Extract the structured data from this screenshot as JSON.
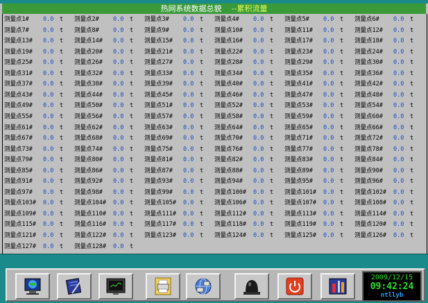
{
  "header": {
    "title": "热网系统数据总貌",
    "subtitle": "--累积流量"
  },
  "measurement": {
    "prefix": "测量点",
    "unit": "t",
    "columns": 6,
    "points": [
      {
        "label": "测量点1#",
        "value": "0.0"
      },
      {
        "label": "测量点2#",
        "value": "0.0"
      },
      {
        "label": "测量点3#",
        "value": "0.0"
      },
      {
        "label": "测量点4#",
        "value": "0.0"
      },
      {
        "label": "测量点5#",
        "value": "0.0"
      },
      {
        "label": "测量点6#",
        "value": "0.0"
      },
      {
        "label": "测量点7#",
        "value": "0.0"
      },
      {
        "label": "测量点8#",
        "value": "0.0"
      },
      {
        "label": "测量点9#",
        "value": "0.0"
      },
      {
        "label": "测量点10#",
        "value": "0.0"
      },
      {
        "label": "测量点11#",
        "value": "0.0"
      },
      {
        "label": "测量点12#",
        "value": "0.0"
      },
      {
        "label": "测量点13#",
        "value": "0.0"
      },
      {
        "label": "测量点14#",
        "value": "0.0"
      },
      {
        "label": "测量点15#",
        "value": "0.0"
      },
      {
        "label": "测量点16#",
        "value": "0.0"
      },
      {
        "label": "测量点17#",
        "value": "0.0"
      },
      {
        "label": "测量点18#",
        "value": "0.0"
      },
      {
        "label": "测量点19#",
        "value": "0.0"
      },
      {
        "label": "测量点20#",
        "value": "0.0"
      },
      {
        "label": "测量点21#",
        "value": "0.0"
      },
      {
        "label": "测量点22#",
        "value": "0.0"
      },
      {
        "label": "测量点23#",
        "value": "0.0"
      },
      {
        "label": "测量点24#",
        "value": "0.0"
      },
      {
        "label": "测量点25#",
        "value": "0.0"
      },
      {
        "label": "测量点26#",
        "value": "0.0"
      },
      {
        "label": "测量点27#",
        "value": "0.0"
      },
      {
        "label": "测量点28#",
        "value": "0.0"
      },
      {
        "label": "测量点29#",
        "value": "0.0"
      },
      {
        "label": "测量点30#",
        "value": "0.0"
      },
      {
        "label": "测量点31#",
        "value": "0.0"
      },
      {
        "label": "测量点32#",
        "value": "0.0"
      },
      {
        "label": "测量点33#",
        "value": "0.0"
      },
      {
        "label": "测量点34#",
        "value": "0.0"
      },
      {
        "label": "测量点35#",
        "value": "0.0"
      },
      {
        "label": "测量点36#",
        "value": "0.0"
      },
      {
        "label": "测量点37#",
        "value": "0.0"
      },
      {
        "label": "测量点38#",
        "value": "0.0"
      },
      {
        "label": "测量点39#",
        "value": "0.0"
      },
      {
        "label": "测量点40#",
        "value": "0.0"
      },
      {
        "label": "测量点41#",
        "value": "0.0"
      },
      {
        "label": "测量点42#",
        "value": "0.0"
      },
      {
        "label": "测量点43#",
        "value": "0.0"
      },
      {
        "label": "测量点44#",
        "value": "0.0"
      },
      {
        "label": "测量点45#",
        "value": "0.0"
      },
      {
        "label": "测量点46#",
        "value": "0.0"
      },
      {
        "label": "测量点47#",
        "value": "0.0"
      },
      {
        "label": "测量点48#",
        "value": "0.0"
      },
      {
        "label": "测量点49#",
        "value": "0.0"
      },
      {
        "label": "测量点50#",
        "value": "0.0"
      },
      {
        "label": "测量点51#",
        "value": "0.0"
      },
      {
        "label": "测量点52#",
        "value": "0.0"
      },
      {
        "label": "测量点53#",
        "value": "0.0"
      },
      {
        "label": "测量点54#",
        "value": "0.0"
      },
      {
        "label": "测量点55#",
        "value": "0.0"
      },
      {
        "label": "测量点56#",
        "value": "0.0"
      },
      {
        "label": "测量点57#",
        "value": "0.0"
      },
      {
        "label": "测量点58#",
        "value": "0.0"
      },
      {
        "label": "测量点59#",
        "value": "0.0"
      },
      {
        "label": "测量点60#",
        "value": "0.0"
      },
      {
        "label": "测量点61#",
        "value": "0.0"
      },
      {
        "label": "测量点62#",
        "value": "0.0"
      },
      {
        "label": "测量点63#",
        "value": "0.0"
      },
      {
        "label": "测量点64#",
        "value": "0.0"
      },
      {
        "label": "测量点65#",
        "value": "0.0"
      },
      {
        "label": "测量点66#",
        "value": "0.0"
      },
      {
        "label": "测量点67#",
        "value": "0.0"
      },
      {
        "label": "测量点68#",
        "value": "0.0"
      },
      {
        "label": "测量点69#",
        "value": "0.0"
      },
      {
        "label": "测量点70#",
        "value": "0.0"
      },
      {
        "label": "测量点71#",
        "value": "0.0"
      },
      {
        "label": "测量点72#",
        "value": "0.0"
      },
      {
        "label": "测量点73#",
        "value": "0.0"
      },
      {
        "label": "测量点74#",
        "value": "0.0"
      },
      {
        "label": "测量点75#",
        "value": "0.0"
      },
      {
        "label": "测量点76#",
        "value": "0.0"
      },
      {
        "label": "测量点77#",
        "value": "0.0"
      },
      {
        "label": "测量点78#",
        "value": "0.0"
      },
      {
        "label": "测量点79#",
        "value": "0.0"
      },
      {
        "label": "测量点80#",
        "value": "0.0"
      },
      {
        "label": "测量点81#",
        "value": "0.0"
      },
      {
        "label": "测量点82#",
        "value": "0.0"
      },
      {
        "label": "测量点83#",
        "value": "0.0"
      },
      {
        "label": "测量点84#",
        "value": "0.0"
      },
      {
        "label": "测量点85#",
        "value": "0.0"
      },
      {
        "label": "测量点86#",
        "value": "0.0"
      },
      {
        "label": "测量点87#",
        "value": "0.0"
      },
      {
        "label": "测量点88#",
        "value": "0.0"
      },
      {
        "label": "测量点89#",
        "value": "0.0"
      },
      {
        "label": "测量点90#",
        "value": "0.0"
      },
      {
        "label": "测量点91#",
        "value": "0.0"
      },
      {
        "label": "测量点92#",
        "value": "0.0"
      },
      {
        "label": "测量点93#",
        "value": "0.0"
      },
      {
        "label": "测量点94#",
        "value": "0.0"
      },
      {
        "label": "测量点95#",
        "value": "0.0"
      },
      {
        "label": "测量点96#",
        "value": "0.0"
      },
      {
        "label": "测量点97#",
        "value": "0.0"
      },
      {
        "label": "测量点98#",
        "value": "0.0"
      },
      {
        "label": "测量点99#",
        "value": "0.0"
      },
      {
        "label": "测量点100#",
        "value": "0.0"
      },
      {
        "label": "测量点101#",
        "value": "0.0"
      },
      {
        "label": "测量点102#",
        "value": "0.0"
      },
      {
        "label": "测量点103#",
        "value": "0.0"
      },
      {
        "label": "测量点104#",
        "value": "0.0"
      },
      {
        "label": "测量点105#",
        "value": "0.0"
      },
      {
        "label": "测量点106#",
        "value": "0.0"
      },
      {
        "label": "测量点107#",
        "value": "0.0"
      },
      {
        "label": "测量点108#",
        "value": "0.0"
      },
      {
        "label": "测量点109#",
        "value": "0.0"
      },
      {
        "label": "测量点110#",
        "value": "0.0"
      },
      {
        "label": "测量点111#",
        "value": "0.0"
      },
      {
        "label": "测量点112#",
        "value": "0.0"
      },
      {
        "label": "测量点113#",
        "value": "0.0"
      },
      {
        "label": "测量点114#",
        "value": "0.0"
      },
      {
        "label": "测量点115#",
        "value": "0.0"
      },
      {
        "label": "测量点116#",
        "value": "0.0"
      },
      {
        "label": "测量点117#",
        "value": "0.0"
      },
      {
        "label": "测量点118#",
        "value": "0.0"
      },
      {
        "label": "测量点119#",
        "value": "0.0"
      },
      {
        "label": "测量点120#",
        "value": "0.0"
      },
      {
        "label": "测量点121#",
        "value": "0.0"
      },
      {
        "label": "测量点122#",
        "value": "0.0"
      },
      {
        "label": "测量点123#",
        "value": "0.0"
      },
      {
        "label": "测量点124#",
        "value": "0.0"
      },
      {
        "label": "测量点125#",
        "value": "0.0"
      },
      {
        "label": "测量点126#",
        "value": "0.0"
      },
      {
        "label": "测量点127#",
        "value": "0.0"
      },
      {
        "label": "测量点128#",
        "value": "0.0"
      }
    ]
  },
  "toolbar": {
    "buttons": [
      {
        "name": "network-overview-button",
        "icon": "globe-monitor-icon"
      },
      {
        "name": "edit-button",
        "icon": "notepad-pen-icon"
      },
      {
        "name": "trend-monitor-button",
        "icon": "monitor-icon"
      },
      {
        "name": "print-button",
        "icon": "printer-icon"
      },
      {
        "name": "network-button",
        "icon": "network-globe-icon"
      },
      {
        "name": "alarm-button",
        "icon": "alarm-bell-icon"
      },
      {
        "name": "power-button",
        "icon": "power-icon"
      },
      {
        "name": "tools-button",
        "icon": "tools-icon"
      }
    ]
  },
  "clock": {
    "date": "2009/12/15",
    "time": "09:42:24",
    "user": "ntllyb"
  },
  "colors": {
    "teal": "#1a8a8a",
    "title_bar": "#3a9a3a",
    "value_blue": "#1a4fbf",
    "clock_green": "#29e029"
  }
}
